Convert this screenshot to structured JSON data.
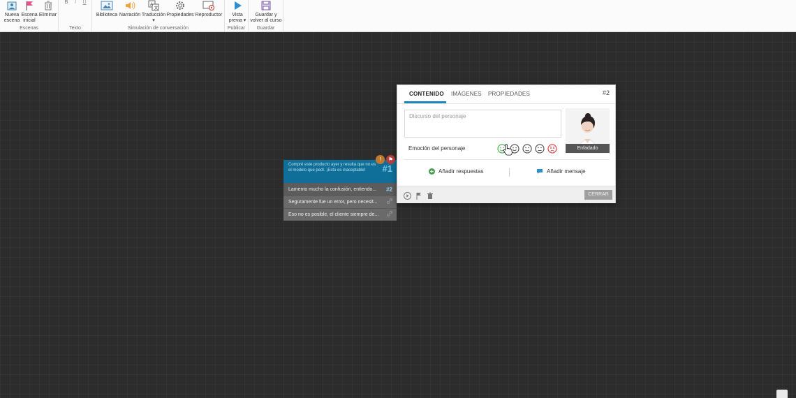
{
  "ribbon": {
    "groups": [
      {
        "label": "Escenas",
        "buttons": [
          {
            "label_line1": "Nueva",
            "label_line2": "escena",
            "icon": "new-scene-icon"
          },
          {
            "label_line1": "Escena",
            "label_line2": "inicial",
            "icon": "flag-icon"
          },
          {
            "label_line1": "Eliminar",
            "label_line2": "",
            "icon": "trash-icon"
          }
        ]
      },
      {
        "label": "Texto",
        "buttons": [
          {
            "label_line1": "B",
            "icon": "bold-icon"
          },
          {
            "label_line1": "I",
            "icon": "italic-icon"
          },
          {
            "label_line1": "U",
            "icon": "underline-icon"
          }
        ]
      },
      {
        "label": "Simulación de conversación",
        "buttons": [
          {
            "label_line1": "Biblioteca",
            "icon": "image-library-icon"
          },
          {
            "label_line1": "Narración",
            "icon": "speaker-icon"
          },
          {
            "label_line1": "Traducción",
            "label_line2": "▾",
            "icon": "translate-icon"
          },
          {
            "label_line1": "Propiedades",
            "icon": "gear-icon"
          },
          {
            "label_line1": "Reproductor",
            "icon": "player-icon"
          }
        ]
      },
      {
        "label": "Publicar",
        "buttons": [
          {
            "label_line1": "Vista",
            "label_line2": "previa ▾",
            "icon": "play-icon"
          }
        ]
      },
      {
        "label": "Guardar",
        "buttons": [
          {
            "label_line1": "Guardar y",
            "label_line2": "volver al curso",
            "icon": "save-icon"
          }
        ]
      }
    ]
  },
  "node": {
    "text": "Compré este producto ayer y resulta que no es el modelo que pedí. ¡Esto es inaceptable!",
    "number": "#1",
    "responses": [
      {
        "text": "Lamento mucho la confusión, entiendo...",
        "tag": "#2"
      },
      {
        "text": "Seguramente fue un error, pero necesit...",
        "tag": "link-icon"
      },
      {
        "text": "Eso no es posible, el cliente siempre de...",
        "tag": "link-icon"
      }
    ]
  },
  "panel": {
    "tabs": [
      "CONTENIDO",
      "IMÁGENES",
      "PROPIEDADES"
    ],
    "scene_number": "#2",
    "speech_placeholder": "Discurso del personaje",
    "emotion_label": "Emoción del personaje",
    "emotion_selected": "Enfadado",
    "emotions": [
      "happy",
      "neutral-smile",
      "neutral",
      "sad",
      "angry"
    ],
    "add_responses": "Añadir respuestas",
    "add_message": "Añadir mensaje",
    "close_label": "CERRAR"
  },
  "colors": {
    "canvas": "#2c2c2c",
    "node_header": "#0f6f98",
    "accent": "#1d86bf",
    "response_bg": "#6a6a6a"
  }
}
